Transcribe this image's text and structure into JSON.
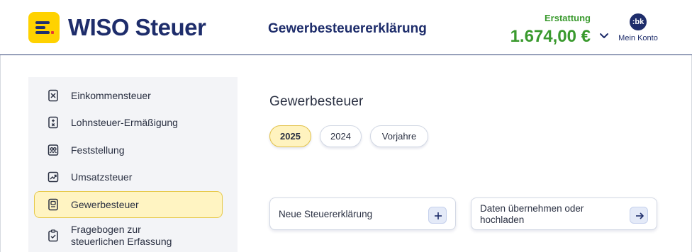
{
  "header": {
    "brand": "WISO Steuer",
    "document_title": "Gewerbesteuererklärung",
    "refund_label": "Erstattung",
    "refund_amount": "1.674,00 €",
    "account_initials": ":bk",
    "account_label": "Mein Konto"
  },
  "sidebar": {
    "items": [
      {
        "label": "Einkommensteuer",
        "icon": "tax-form-icon",
        "active": false
      },
      {
        "label": "Lohnsteuer-Ermäßigung",
        "icon": "calculator-doc-icon",
        "active": false
      },
      {
        "label": "Feststellung",
        "icon": "people-doc-icon",
        "active": false
      },
      {
        "label": "Umsatzsteuer",
        "icon": "chart-trend-icon",
        "active": false
      },
      {
        "label": "Gewerbesteuer",
        "icon": "business-doc-icon",
        "active": true
      },
      {
        "label": "Fragebogen zur steuerlichen Erfassung",
        "label_line1": "Fragebogen zur",
        "label_line2": "steuerlichen Erfassung",
        "icon": "clipboard-check-icon",
        "active": false
      }
    ]
  },
  "main": {
    "title": "Gewerbesteuer",
    "year_tabs": [
      {
        "label": "2025",
        "active": true
      },
      {
        "label": "2024",
        "active": false
      },
      {
        "label": "Vorjahre",
        "active": false
      }
    ],
    "actions": [
      {
        "label": "Neue Steuererklärung",
        "icon": "plus-icon"
      },
      {
        "label": "Daten übernehmen oder hochladen",
        "label_line1": "Daten übernehmen oder",
        "label_line2": "hochladen",
        "icon": "arrow-right-icon"
      }
    ]
  },
  "colors": {
    "brand_navy": "#1e2d6b",
    "brand_yellow": "#ffd200",
    "refund_green": "#3a9a2e",
    "active_highlight": "#fff4c2"
  }
}
